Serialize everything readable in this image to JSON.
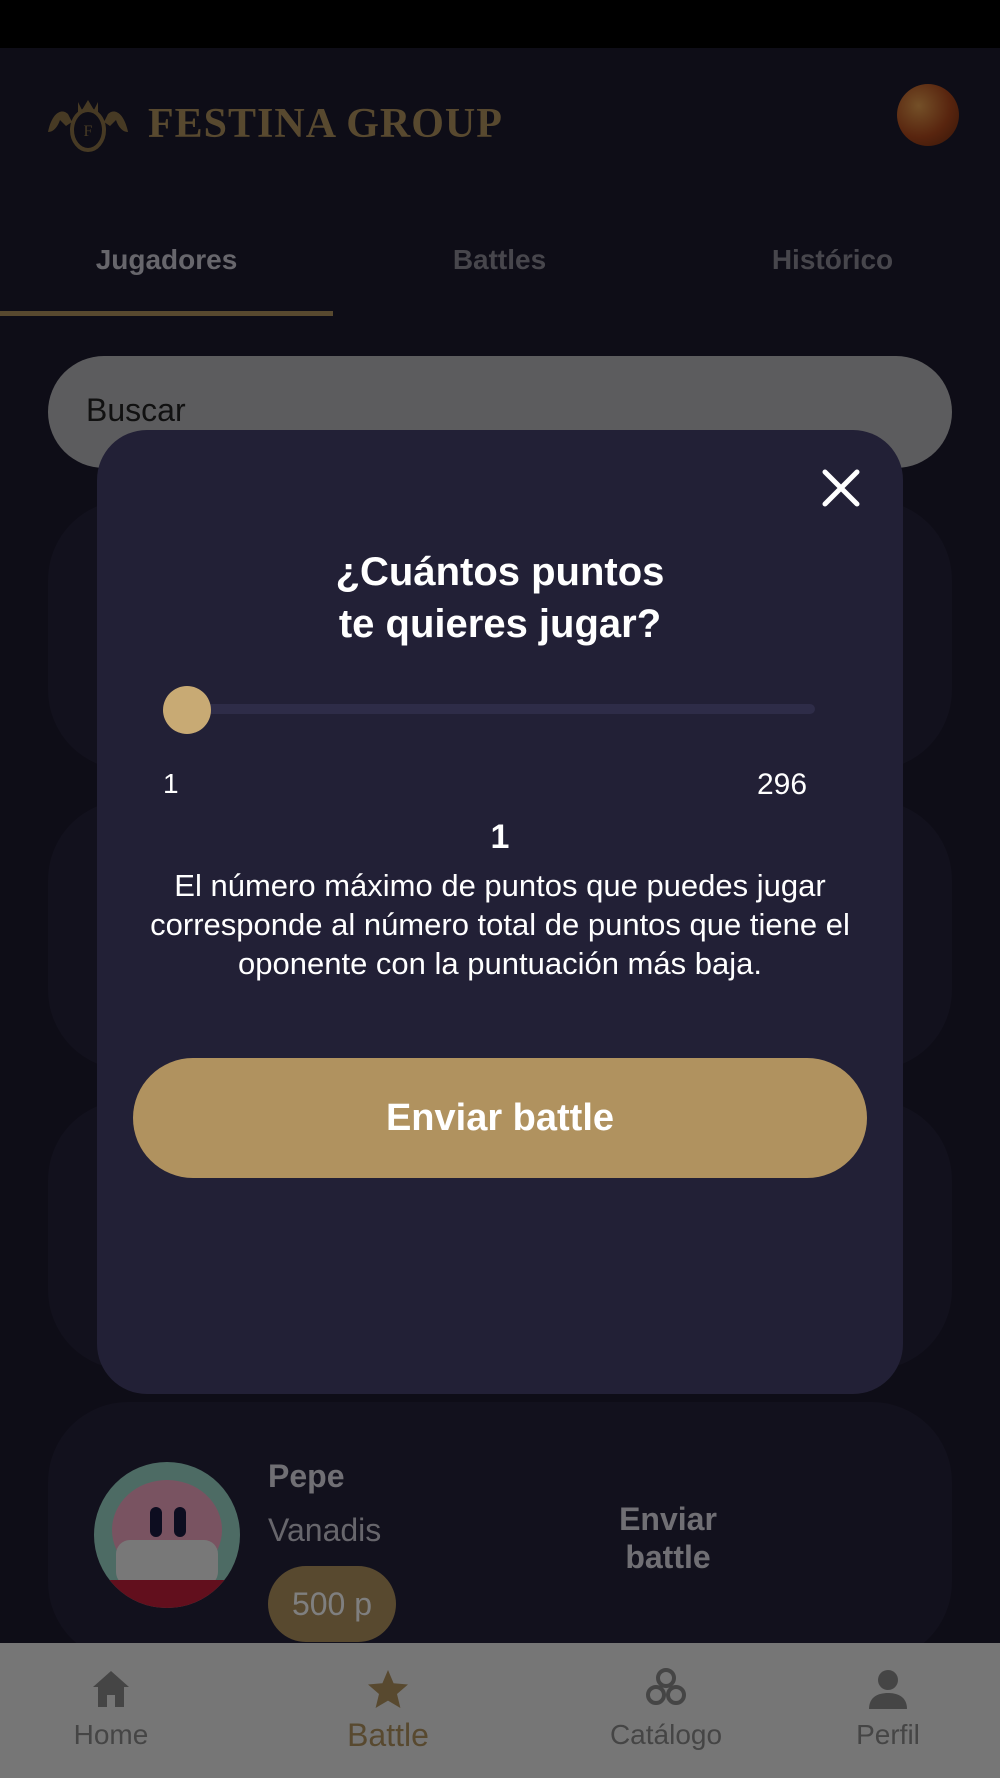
{
  "header": {
    "brand": "FESTINA GROUP"
  },
  "tabs": [
    {
      "label": "Jugadores",
      "active": true
    },
    {
      "label": "Battles",
      "active": false
    },
    {
      "label": "Histórico",
      "active": false
    }
  ],
  "search": {
    "placeholder": "Buscar"
  },
  "player": {
    "name": "Pepe",
    "team": "Vanadis",
    "points": "500 p",
    "action": "Enviar battle"
  },
  "bottom_nav": [
    {
      "label": "Home",
      "icon": "home-icon",
      "active": false
    },
    {
      "label": "Battle",
      "icon": "star-icon",
      "active": true
    },
    {
      "label": "Catálogo",
      "icon": "catalog-icon",
      "active": false
    },
    {
      "label": "Perfil",
      "icon": "user-icon",
      "active": false
    }
  ],
  "modal": {
    "title_line1": "¿Cuántos puntos",
    "title_line2": "te quieres jugar?",
    "slider": {
      "min_label": "1",
      "max_label": "296",
      "value": "1",
      "min": 1,
      "max": 296,
      "current": 1
    },
    "description": "El número máximo de puntos que puedes jugar corresponde al número total de puntos que tiene el oponente con la puntuación más baja.",
    "submit_label": "Enviar battle"
  },
  "colors": {
    "accent": "#b0925f",
    "modal_bg": "#222036",
    "app_bg": "#1c1a2e"
  }
}
